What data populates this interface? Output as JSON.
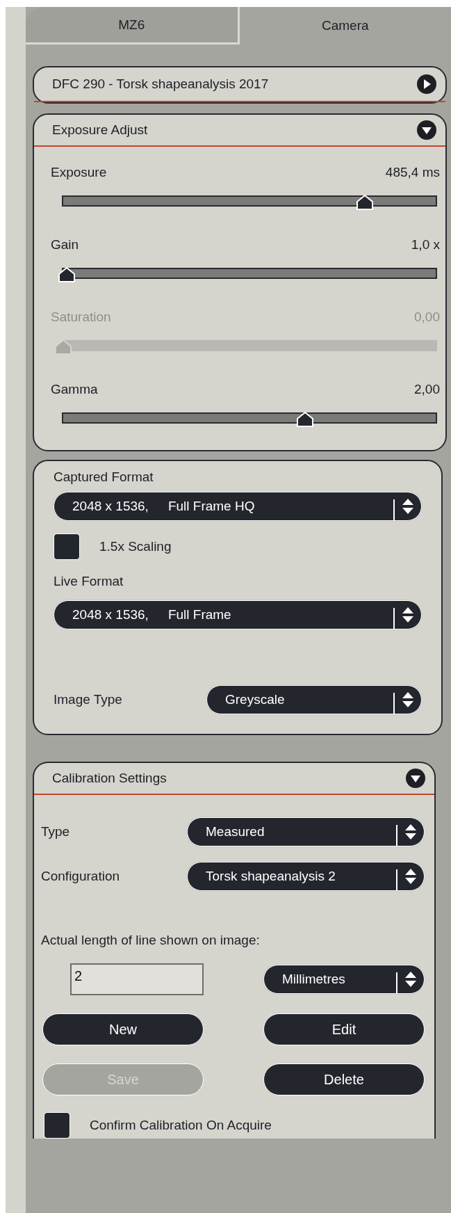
{
  "tabs": [
    {
      "label": "MZ6",
      "selected": false
    },
    {
      "label": "Camera",
      "selected": true
    }
  ],
  "device_panel": {
    "title": "DFC 290 - Torsk shapeanalysis 2017",
    "expanded": false
  },
  "exposure_panel": {
    "title": "Exposure Adjust",
    "expanded": true,
    "sliders": [
      {
        "label": "Exposure",
        "reading": "485,4 ms",
        "level": 0.81,
        "disabled": false
      },
      {
        "label": "Gain",
        "reading": "1,0 x",
        "level": 0.01,
        "disabled": false
      },
      {
        "label": "Saturation",
        "reading": "0,00",
        "level": 0.0,
        "disabled": true
      },
      {
        "label": "Gamma",
        "reading": "2,00",
        "level": 0.65,
        "disabled": false
      }
    ]
  },
  "format_panel": {
    "captured_format": {
      "label": "Captured Format",
      "resolution": "2048 x 1536,",
      "mode": "Full Frame HQ"
    },
    "scaling": {
      "label": "1.5x Scaling",
      "checked": false
    },
    "live_format": {
      "label": "Live Format",
      "resolution": "2048 x 1536,",
      "mode": "Full Frame"
    },
    "image_type": {
      "label": "Image Type",
      "value": "Greyscale"
    }
  },
  "calibration_panel": {
    "title": "Calibration Settings",
    "expanded": true,
    "type": {
      "label": "Type",
      "value": "Measured"
    },
    "configuration": {
      "label": "Configuration",
      "value": "Torsk  shapeanalysis 2"
    },
    "length_prompt": "Actual length of line shown on image:",
    "length": {
      "value": "2",
      "unit": "Millimetres"
    },
    "buttons": [
      {
        "label": "New",
        "disabled": false
      },
      {
        "label": "Edit",
        "disabled": false
      },
      {
        "label": "Save",
        "disabled": true
      },
      {
        "label": "Delete",
        "disabled": false
      }
    ],
    "confirm": {
      "label": "Confirm Calibration On Acquire",
      "checked": false
    }
  }
}
